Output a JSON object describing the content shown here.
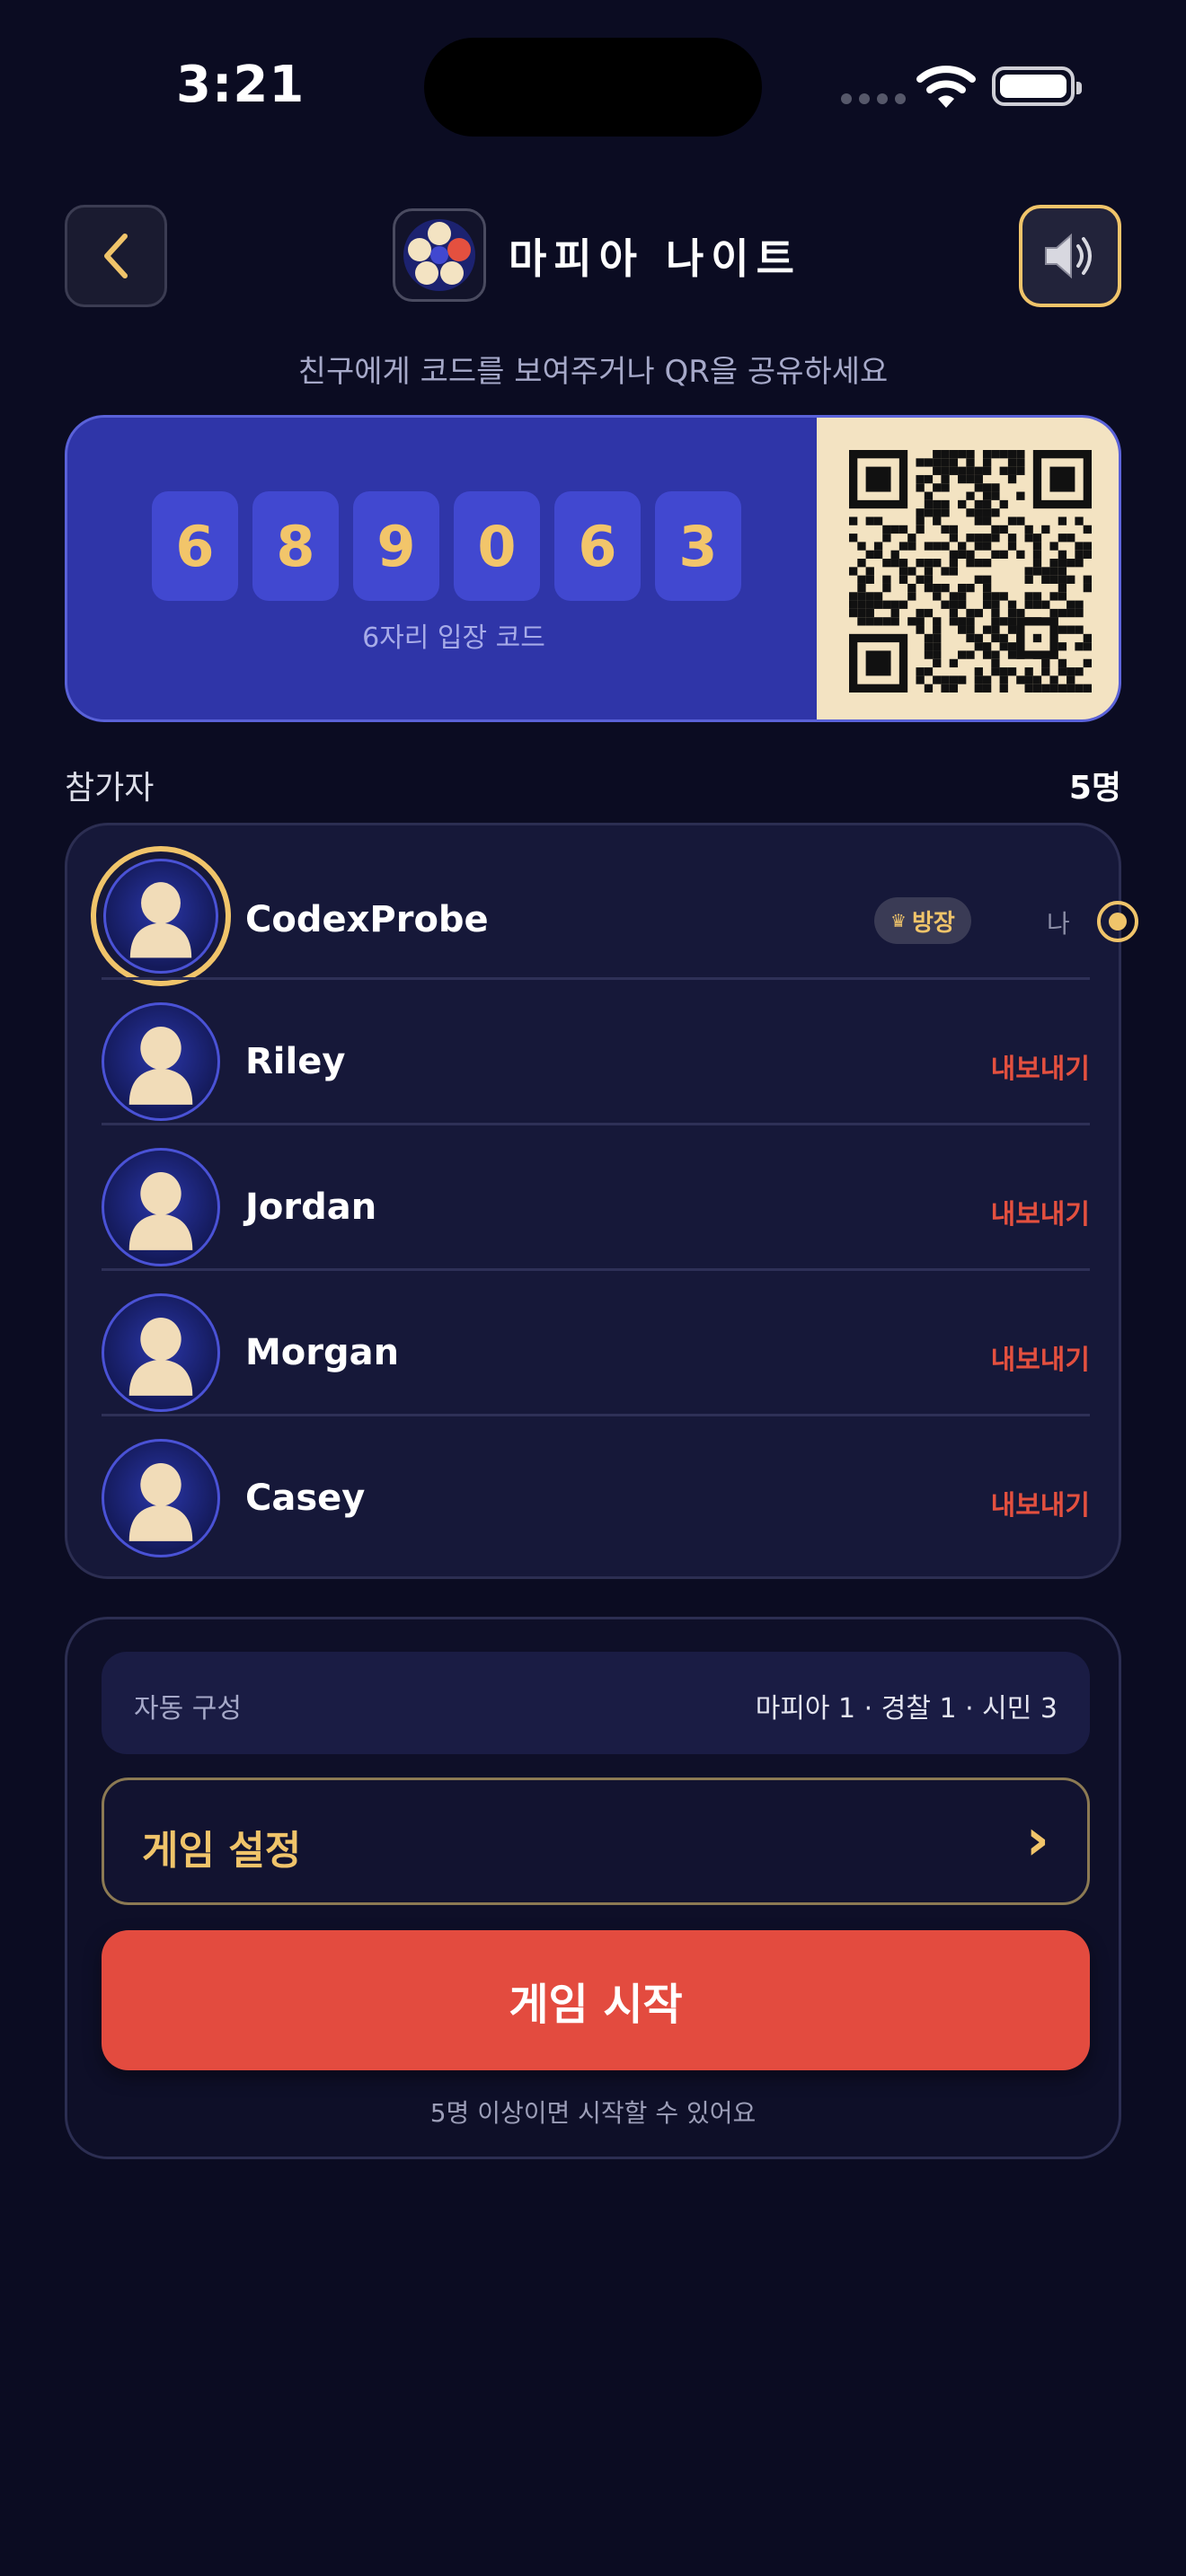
{
  "status_bar": {
    "time": "3:21"
  },
  "header": {
    "title": "마피아 나이트",
    "back_icon": "chevron-left-icon",
    "sound_icon": "speaker-icon"
  },
  "subtitle": "친구에게 코드를 보여주거나 QR을 공유하세요",
  "code": {
    "digits": [
      "6",
      "8",
      "9",
      "0",
      "6",
      "3"
    ],
    "caption": "6자리 입장 코드"
  },
  "participants": {
    "label": "참가자",
    "count": "5명",
    "players": [
      {
        "name": "CodexProbe",
        "is_me": true,
        "host_badge": "방장",
        "me_label": "나"
      },
      {
        "name": "Riley",
        "kick_label": "내보내기"
      },
      {
        "name": "Jordan",
        "kick_label": "내보내기"
      },
      {
        "name": "Morgan",
        "kick_label": "내보내기"
      },
      {
        "name": "Casey",
        "kick_label": "내보내기"
      }
    ]
  },
  "settings": {
    "composition_label": "자동 구성",
    "composition_value": "마피아 1 · 경찰 1 · 시민 3",
    "game_settings_label": "게임 설정",
    "start_label": "게임 시작",
    "start_hint": "5명 이상이면 시작할 수 있어요"
  },
  "colors": {
    "background": "#0b0c22",
    "accent_gold": "#f0c46a",
    "danger_red": "#e4503f",
    "code_card": "#2f35a8"
  }
}
